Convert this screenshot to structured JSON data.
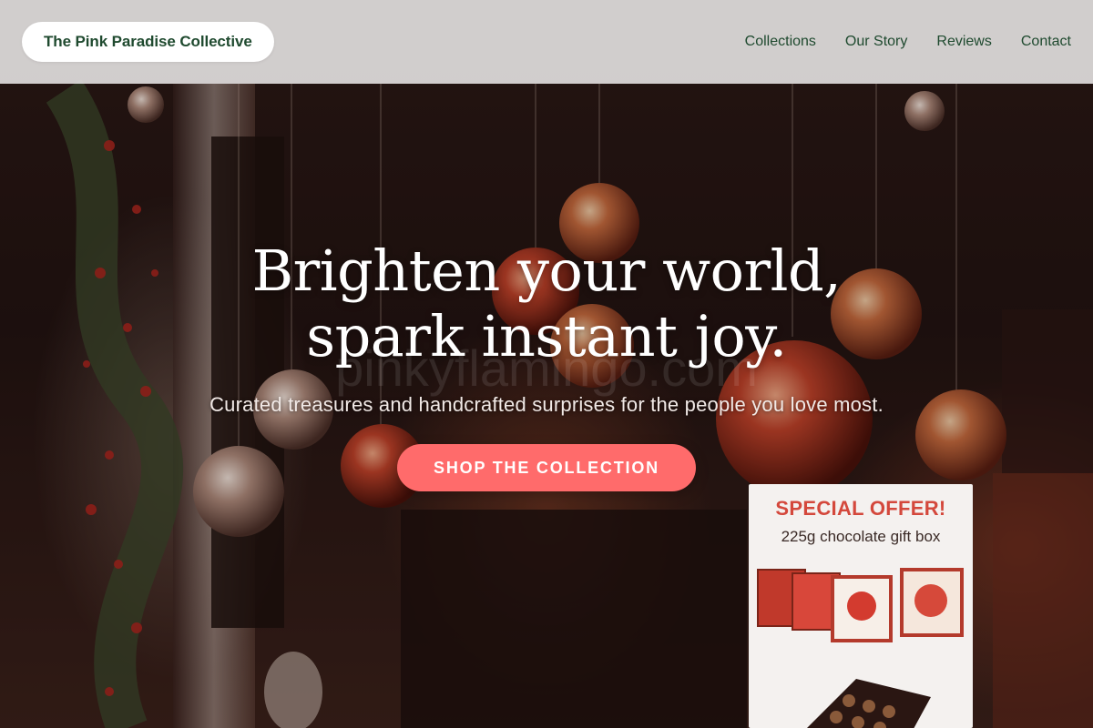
{
  "header": {
    "brand": "The Pink Paradise Collective",
    "nav": [
      {
        "label": "Collections"
      },
      {
        "label": "Our Story"
      },
      {
        "label": "Reviews"
      },
      {
        "label": "Contact"
      }
    ]
  },
  "hero": {
    "title_line1": "Brighten your world,",
    "title_line2": "spark instant joy.",
    "subtitle": "Curated treasures and handcrafted surprises for the people you love most.",
    "cta_label": "SHOP THE COLLECTION",
    "background_image": "holiday-shop-window-with-copper-ornaments",
    "watermark": "pinkyflamingo.com"
  },
  "sign": {
    "title": "SPECIAL OFFER!",
    "subtitle": "225g chocolate gift box"
  },
  "colors": {
    "brand_green": "#1f4a2f",
    "accent_coral": "#ff6b6b",
    "topbar_bg": "#e4e2e2",
    "hero_text": "#ffffff"
  }
}
